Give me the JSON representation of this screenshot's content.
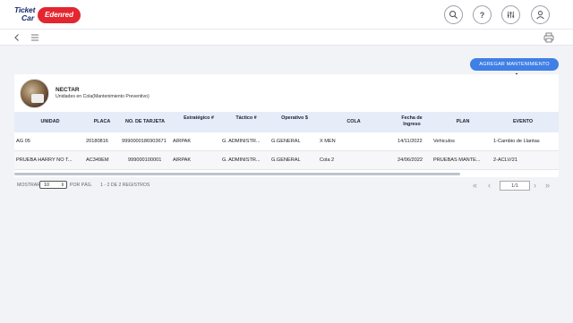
{
  "brand": {
    "line1": "Ticket",
    "line2": "Car",
    "badge": "Edenred"
  },
  "header": {
    "icons": [
      "search-icon",
      "help-icon",
      "sliders-icon",
      "user-icon"
    ],
    "help_glyph": "?"
  },
  "toolbar": {
    "add_button": "AGREGAR MANTENIMIENTO"
  },
  "card": {
    "title": "NECTAR",
    "subtitle": "Unidades en Cola(Mantenimiento Preventivo)"
  },
  "table": {
    "headers": {
      "unidad": "UNIDAD",
      "placa": "PLACA",
      "tarjeta": "NO. DE TARJETA",
      "estrategico": "Estratégico #",
      "tactico": "Táctico #",
      "operativo": "Operativo $",
      "cola": "COLA",
      "fecha1": "Fecha de",
      "fecha2": "Ingreso",
      "plan": "PLAN",
      "evento": "EVENTO"
    },
    "rows": [
      {
        "unidad": "AG 05",
        "placa": "20180816",
        "tarjeta": "9990000186903671",
        "estrategico": "AIRPAK",
        "tactico": "G. ADMINISTR...",
        "operativo": "G.GENERAL",
        "cola": "X MEN",
        "fecha": "14/11/2022",
        "plan": "Vehiculos",
        "evento": "1-Cambio de Llantas"
      },
      {
        "unidad": "PRUEBA HARRY NO T...",
        "placa": "AC349EM",
        "tarjeta": "999000100001",
        "estrategico": "AIRPAK",
        "tactico": "G. ADMINISTR...",
        "operativo": "G.GENERAL",
        "cola": "Cola 2",
        "fecha": "24/06/2022",
        "plan": "PRUEBAS MANTE...",
        "evento": "2-ACLV/21"
      }
    ]
  },
  "pagination": {
    "show_label": "MOSTRAR",
    "page_size": "10",
    "per_page_label": "POR PÁG.",
    "records": "1 - 2 DE 2 REGISTROS",
    "page": "1/1",
    "first": "«",
    "prev": "‹",
    "next": "›",
    "last": "»"
  }
}
